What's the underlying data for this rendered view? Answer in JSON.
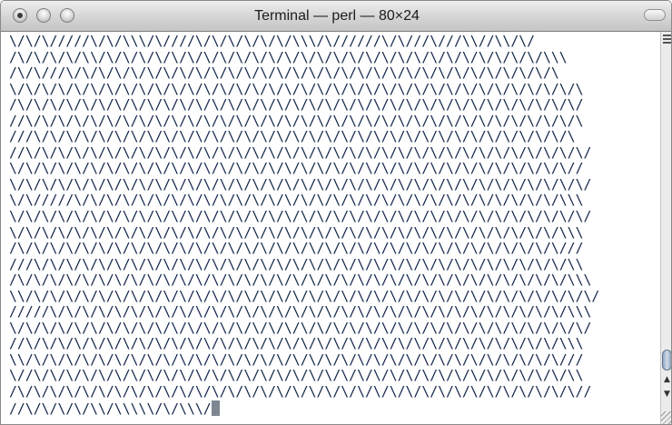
{
  "window": {
    "title": "Terminal — perl — 80×24"
  },
  "terminal": {
    "lines": [
      "\\/\\/\\/////\\/\\/\\\\\\/\\////\\/\\/\\/\\/\\/\\/\\\\\\/\\//////\\/\\///\\///\\\\//\\\\/\\/",
      "/\\/\\/\\/\\/\\\\/\\/\\/\\/\\/\\/\\/\\/\\/\\/\\/\\/\\/\\/\\/\\/\\/\\/\\/\\/\\/\\/\\/\\/\\/\\/\\/\\/\\\\\\",
      "/\\/\\///\\/\\/\\/\\/\\/\\/\\/\\/\\/\\/\\/\\/\\/\\/\\/\\/\\/\\/\\/\\/\\/\\/\\/\\/\\/\\/\\/\\/\\/\\/\\",
      "\\/\\/\\/\\/\\/\\/\\/\\/\\/\\/\\/\\/\\/\\/\\/\\/\\/\\/\\/\\/\\/\\/\\/\\/\\/\\/\\/\\/\\/\\/\\/\\/\\/\\/\\/\\",
      "/\\/\\/\\/\\/\\/\\/\\/\\/\\/\\/\\/\\/\\/\\/\\/\\/\\/\\/\\/\\/\\/\\/\\/\\/\\/\\/\\/\\/\\/\\/\\/\\/\\/\\/\\/",
      "//\\/\\/\\/\\/\\/\\/\\/\\/\\/\\/\\/\\/\\/\\/\\/\\/\\/\\/\\/\\/\\/\\/\\/\\/\\/\\/\\/\\/\\/\\/\\/\\/\\/\\/\\",
      "///\\/\\/\\/\\/\\/\\/\\/\\/\\/\\/\\/\\/\\/\\/\\/\\/\\/\\/\\/\\/\\/\\/\\/\\/\\/\\/\\/\\/\\/\\/\\/\\/\\/\\",
      "//\\/\\/\\/\\/\\/\\/\\/\\/\\/\\/\\/\\/\\/\\/\\/\\/\\/\\/\\/\\/\\/\\/\\/\\/\\/\\/\\/\\/\\/\\/\\/\\/\\/\\/\\/",
      "\\/\\/\\/\\/\\/\\/\\/\\/\\/\\/\\/\\/\\/\\/\\/\\/\\/\\/\\/\\/\\/\\/\\/\\/\\/\\/\\/\\/\\/\\/\\/\\/\\/\\/\\//",
      "\\/\\/\\/\\/\\/\\/\\/\\/\\/\\/\\/\\/\\/\\/\\/\\/\\/\\/\\/\\/\\/\\/\\/\\/\\/\\/\\/\\/\\/\\/\\/\\/\\/\\/\\/\\/",
      "\\/\\/////\\/\\/\\/\\/\\/\\/\\/\\/\\/\\/\\/\\/\\/\\/\\/\\/\\/\\/\\/\\/\\/\\/\\/\\/\\/\\/\\/\\/\\/\\/\\\\\\",
      "\\/\\/\\/\\/\\/\\/\\/\\/\\/\\/\\/\\/\\/\\/\\/\\/\\/\\/\\/\\/\\/\\/\\/\\/\\/\\/\\/\\/\\/\\/\\/\\/\\/\\/\\/\\/",
      "\\/\\/\\/\\/\\/\\/\\/\\/\\/\\/\\/\\/\\/\\/\\/\\/\\/\\/\\/\\/\\/\\/\\/\\/\\/\\/\\/\\/\\/\\/\\/\\/\\/\\/\\\\\\",
      "/\\/\\/\\/\\/\\/\\/\\/\\/\\/\\/\\/\\/\\/\\/\\/\\/\\/\\/\\/\\/\\/\\/\\/\\/\\/\\/\\/\\/\\/\\/\\/\\/\\/\\///",
      "///\\/\\/\\/\\/\\/\\/\\/\\/\\/\\/\\/\\/\\/\\/\\/\\/\\/\\/\\/\\/\\/\\/\\/\\/\\/\\/\\/\\/\\/\\/\\/\\/\\/\\\\",
      "/\\/\\/\\/\\/\\/\\/\\/\\/\\/\\/\\/\\/\\/\\/\\/\\/\\/\\/\\/\\/\\/\\/\\/\\/\\/\\/\\/\\/\\/\\/\\/\\/\\/\\/\\\\\\",
      "\\\\/\\/\\/\\/\\/\\/\\/\\/\\/\\/\\/\\/\\/\\/\\/\\/\\/\\/\\/\\/\\/\\/\\/\\/\\/\\/\\/\\/\\/\\/\\/\\/\\/\\/\\/\\/",
      "/////\\/\\/\\/\\/\\/\\/\\/\\/\\/\\/\\/\\/\\/\\/\\/\\/\\/\\/\\/\\/\\/\\/\\/\\/\\/\\/\\/\\/\\/\\/\\/\\/\\\\\\",
      "\\/\\/\\/\\/\\/\\/\\/\\/\\/\\/\\/\\/\\/\\/\\/\\/\\/\\/\\/\\/\\/\\/\\/\\/\\/\\/\\/\\/\\/\\/\\/\\/\\/\\/\\/\\/",
      "//\\/\\/\\/\\/\\/\\/\\/\\/\\/\\/\\/\\/\\/\\/\\/\\/\\/\\/\\/\\/\\/\\/\\/\\/\\/\\/\\/\\/\\/\\/\\/\\/\\/\\\\\\",
      "\\\\/\\/\\/\\/\\/\\/\\/\\/\\/\\/\\/\\/\\/\\/\\/\\/\\/\\/\\/\\/\\/\\/\\/\\/\\/\\/\\/\\/\\/\\/\\/\\/\\/\\///",
      "\\//\\/\\/\\/\\/\\/\\/\\/\\/\\/\\/\\/\\/\\/\\/\\/\\/\\/\\/\\/\\/\\/\\/\\/\\/\\/\\/\\/\\/\\/\\/\\/\\/\\/\\\\",
      "/\\/\\/\\/\\/\\/\\/\\/\\/\\/\\/\\/\\/\\/\\/\\/\\/\\/\\/\\/\\/\\/\\/\\/\\/\\/\\/\\/\\/\\/\\/\\/\\/\\/\\/\\//"
    ],
    "prompt_line": "//\\/\\/\\/\\/\\\\/\\\\\\\\\\/\\/\\\\\\/"
  },
  "colors": {
    "text": "#15284a",
    "background": "#ffffff",
    "cursor": "#7e8792"
  },
  "icons": {
    "close": "close-icon",
    "minimize": "minimize-icon",
    "zoom": "zoom-icon",
    "toolbar": "toolbar-toggle-icon",
    "scroll_up": "up-arrow-icon",
    "scroll_down": "down-arrow-icon"
  }
}
